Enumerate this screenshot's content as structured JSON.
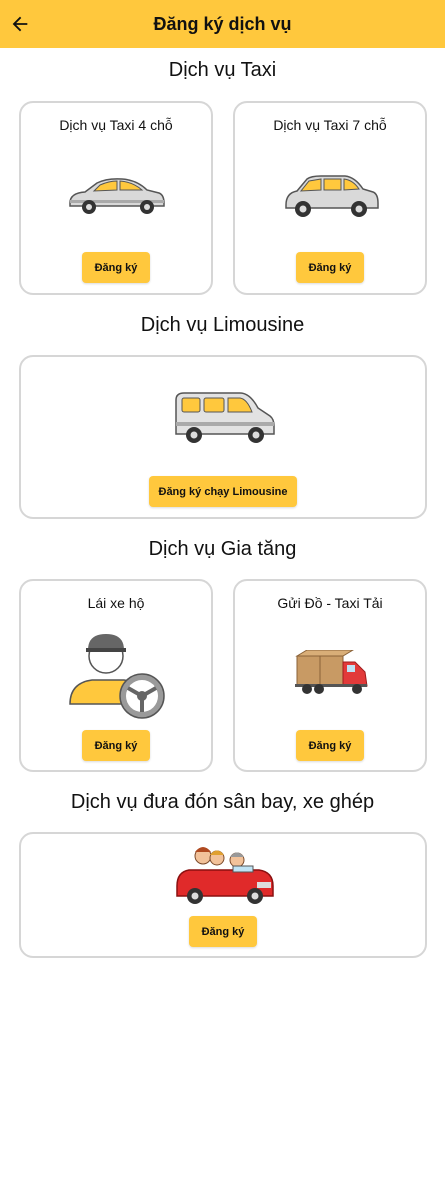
{
  "header": {
    "title": "Đăng ký dịch vụ",
    "back_icon": "arrow-left-icon"
  },
  "sections": {
    "taxi": {
      "title": "Dịch vụ Taxi",
      "cards": [
        {
          "label": "Dịch vụ Taxi 4 chỗ",
          "button": "Đăng ký"
        },
        {
          "label": "Dịch vụ Taxi 7 chỗ",
          "button": "Đăng ký"
        }
      ]
    },
    "limousine": {
      "title": "Dịch vụ Limousine",
      "button": "Đăng ký chạy Limousine"
    },
    "added": {
      "title": "Dịch vụ Gia tăng",
      "cards": [
        {
          "label": "Lái xe hộ",
          "button": "Đăng ký"
        },
        {
          "label": "Gửi Đồ - Taxi Tải",
          "button": "Đăng ký"
        }
      ]
    },
    "airport": {
      "title": "Dịch vụ đưa đón sân bay, xe ghép",
      "button": "Đăng ký"
    }
  },
  "colors": {
    "accent": "#FFC83D",
    "card_border": "#d6d6d6"
  }
}
